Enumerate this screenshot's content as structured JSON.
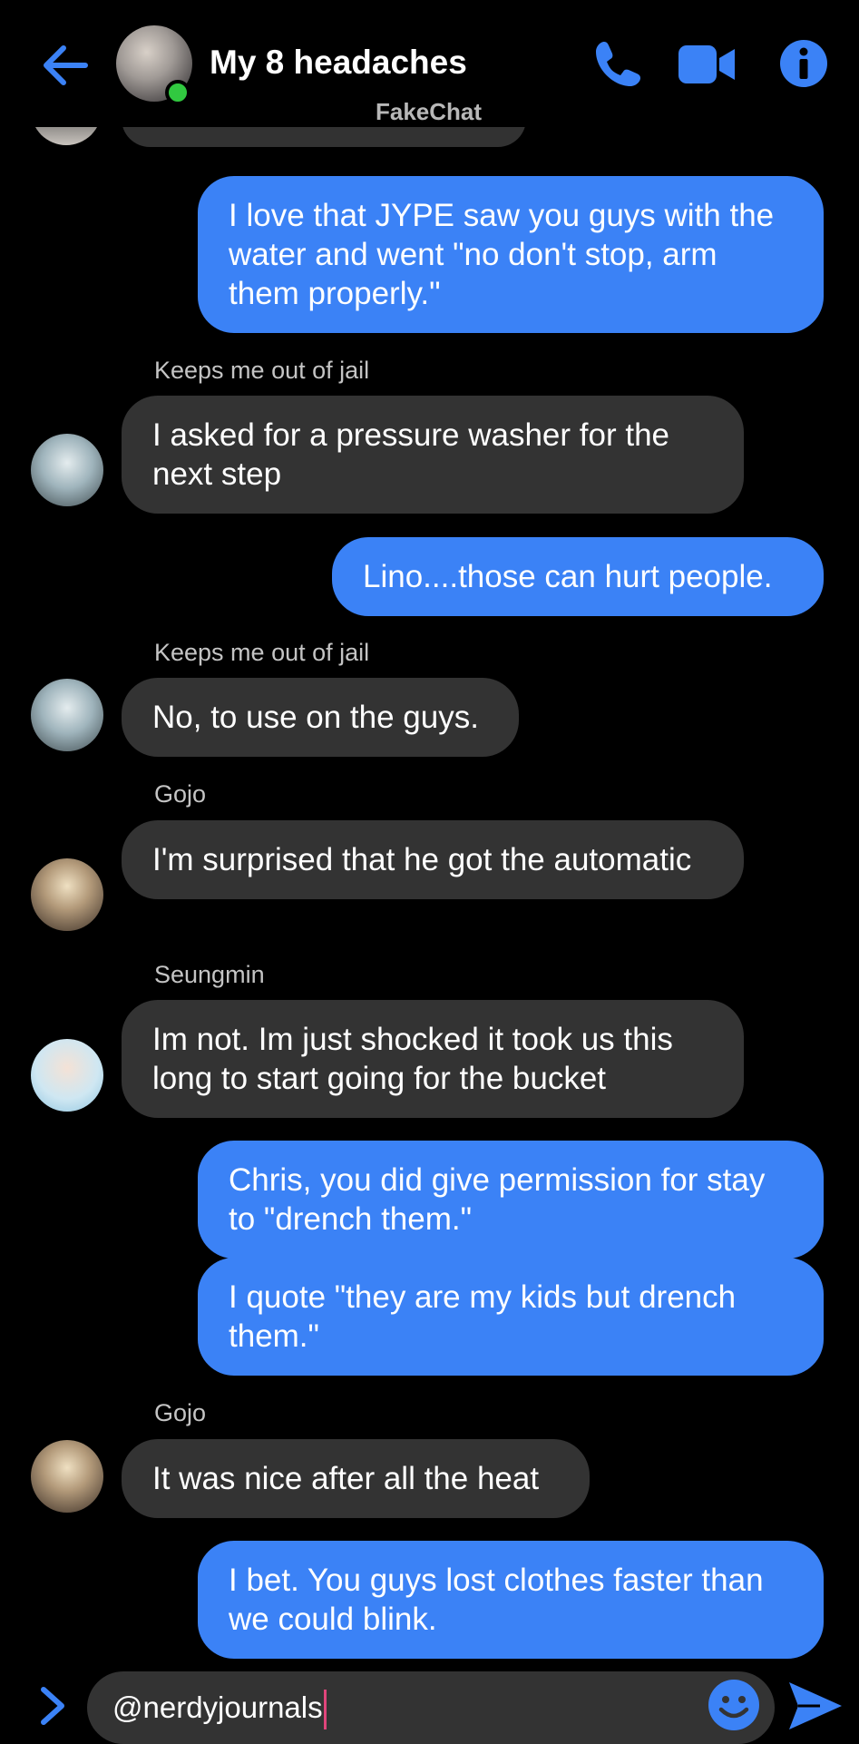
{
  "header": {
    "title": "My 8 headaches",
    "watermark": "FakeChat",
    "icons": [
      "back-arrow-icon",
      "group-avatar",
      "phone-icon",
      "video-camera-icon",
      "info-icon"
    ]
  },
  "messages": [
    {
      "from": "me",
      "text": "I love that JYPE saw you guys with the water and went \"no don't stop, arm them properly.\""
    },
    {
      "from": "them",
      "sender": "Keeps me out of jail",
      "text": "I asked for a pressure washer for the next step"
    },
    {
      "from": "me",
      "text": "Lino....those can hurt people."
    },
    {
      "from": "them",
      "sender": "Keeps me out of jail",
      "text": "No, to use on the guys."
    },
    {
      "from": "them",
      "sender": "Gojo",
      "text": "I'm surprised that he got the automatic"
    },
    {
      "from": "them",
      "sender": "Seungmin",
      "text": "Im not. Im just shocked it took us this long to start going for the bucket"
    },
    {
      "from": "me",
      "text": "Chris, you did give permission for stay to \"drench them.\""
    },
    {
      "from": "me",
      "text": "I quote \"they are my kids but drench them.\""
    },
    {
      "from": "them",
      "sender": "Gojo",
      "text": "It was nice after all the heat"
    },
    {
      "from": "me",
      "text": "I bet. You guys lost clothes faster than we could blink."
    }
  ],
  "composer": {
    "value": "@nerdyjournals"
  },
  "colors": {
    "accent": "#3b82f6",
    "incoming_bubble": "#333333",
    "online": "#31c940",
    "caret": "#e0457b"
  }
}
